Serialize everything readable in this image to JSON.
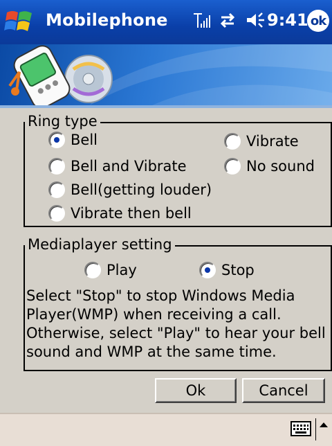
{
  "titlebar": {
    "title": "Mobilephone",
    "clock": "9:41",
    "ok_label": "ok",
    "icons": [
      "start-menu-icon",
      "signal-icon",
      "connectivity-icon",
      "volume-icon"
    ]
  },
  "ring_type": {
    "label": "Ring type",
    "options": [
      {
        "label": "Bell",
        "checked": true
      },
      {
        "label": "Vibrate",
        "checked": false
      },
      {
        "label": "Bell and Vibrate",
        "checked": false
      },
      {
        "label": "No sound",
        "checked": false
      },
      {
        "label": "Bell(getting louder)",
        "checked": false
      },
      {
        "label": "Vibrate then bell",
        "checked": false
      }
    ]
  },
  "mediaplayer": {
    "label": "Mediaplayer  setting",
    "options": [
      {
        "label": "Play",
        "checked": false
      },
      {
        "label": "Stop",
        "checked": true
      }
    ],
    "description": "Select \"Stop\" to stop Windows Media Player(WMP) when receiving a call. Otherwise, select \"Play\" to hear your bell sound and WMP at the same time."
  },
  "buttons": {
    "ok": "Ok",
    "cancel": "Cancel"
  },
  "colors": {
    "titlebar": "#0b3a99",
    "dialog_bg": "#d4d0c8",
    "radio_dot": "#0a36a8",
    "bottombar": "#e8ded5"
  }
}
